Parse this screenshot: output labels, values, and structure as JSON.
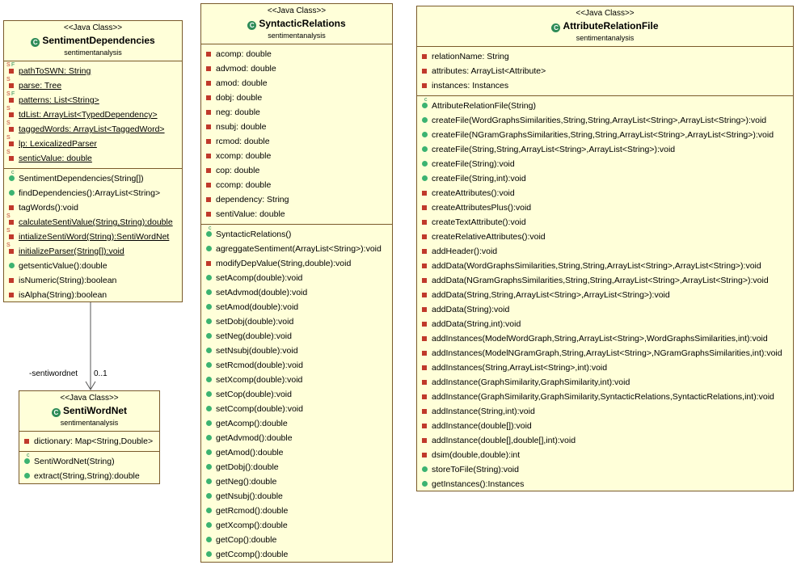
{
  "classes": [
    {
      "id": "SentimentDependencies",
      "stereotype": "<<Java Class>>",
      "name": "SentimentDependencies",
      "package": "sentimentanalysis",
      "fields": [
        {
          "text": "pathToSWN: String",
          "vis": "private",
          "static": true,
          "final": true
        },
        {
          "text": "parse: Tree",
          "vis": "private",
          "static": true,
          "final": false
        },
        {
          "text": "patterns: List<String>",
          "vis": "private",
          "static": true,
          "final": true
        },
        {
          "text": "tdList: ArrayList<TypedDependency>",
          "vis": "private",
          "static": true,
          "final": false
        },
        {
          "text": "taggedWords: ArrayList<TaggedWord>",
          "vis": "private",
          "static": true,
          "final": false
        },
        {
          "text": "lp: LexicalizedParser",
          "vis": "private",
          "static": true,
          "final": false
        },
        {
          "text": "senticValue: double",
          "vis": "private",
          "static": true,
          "final": false
        }
      ],
      "methods": [
        {
          "text": "SentimentDependencies(String[])",
          "vis": "ctor",
          "static": false
        },
        {
          "text": "findDependencies():ArrayList<String>",
          "vis": "public",
          "static": false
        },
        {
          "text": "tagWords():void",
          "vis": "private",
          "static": false
        },
        {
          "text": "calculateSentiValue(String,String):double",
          "vis": "private",
          "static": true
        },
        {
          "text": "intializeSentiWord(String):SentiWordNet",
          "vis": "private",
          "static": true
        },
        {
          "text": "initializeParser(String[]):void",
          "vis": "private",
          "static": true
        },
        {
          "text": "getsenticValue():double",
          "vis": "public",
          "static": false
        },
        {
          "text": "isNumeric(String):boolean",
          "vis": "private",
          "static": false
        },
        {
          "text": "isAlpha(String):boolean",
          "vis": "private",
          "static": false
        }
      ]
    },
    {
      "id": "SentiWordNet",
      "stereotype": "<<Java Class>>",
      "name": "SentiWordNet",
      "package": "sentimentanalysis",
      "fields": [
        {
          "text": "dictionary: Map<String,Double>",
          "vis": "private",
          "static": false,
          "final": false
        }
      ],
      "methods": [
        {
          "text": "SentiWordNet(String)",
          "vis": "ctor",
          "static": false
        },
        {
          "text": "extract(String,String):double",
          "vis": "public",
          "static": false
        }
      ]
    },
    {
      "id": "SyntacticRelations",
      "stereotype": "<<Java Class>>",
      "name": "SyntacticRelations",
      "package": "sentimentanalysis",
      "fields": [
        {
          "text": "acomp: double",
          "vis": "private"
        },
        {
          "text": "advmod: double",
          "vis": "private"
        },
        {
          "text": "amod: double",
          "vis": "private"
        },
        {
          "text": "dobj: double",
          "vis": "private"
        },
        {
          "text": "neg: double",
          "vis": "private"
        },
        {
          "text": "nsubj: double",
          "vis": "private"
        },
        {
          "text": "rcmod: double",
          "vis": "private"
        },
        {
          "text": "xcomp: double",
          "vis": "private"
        },
        {
          "text": "cop: double",
          "vis": "private"
        },
        {
          "text": "ccomp: double",
          "vis": "private"
        },
        {
          "text": "dependency: String",
          "vis": "private"
        },
        {
          "text": "sentiValue: double",
          "vis": "private"
        }
      ],
      "methods": [
        {
          "text": "SyntacticRelations()",
          "vis": "ctor"
        },
        {
          "text": "agreggateSentiment(ArrayList<String>):void",
          "vis": "public"
        },
        {
          "text": "modifyDepValue(String,double):void",
          "vis": "private"
        },
        {
          "text": "setAcomp(double):void",
          "vis": "public"
        },
        {
          "text": "setAdvmod(double):void",
          "vis": "public"
        },
        {
          "text": "setAmod(double):void",
          "vis": "public"
        },
        {
          "text": "setDobj(double):void",
          "vis": "public"
        },
        {
          "text": "setNeg(double):void",
          "vis": "public"
        },
        {
          "text": "setNsubj(double):void",
          "vis": "public"
        },
        {
          "text": "setRcmod(double):void",
          "vis": "public"
        },
        {
          "text": "setXcomp(double):void",
          "vis": "public"
        },
        {
          "text": "setCop(double):void",
          "vis": "public"
        },
        {
          "text": "setCcomp(double):void",
          "vis": "public"
        },
        {
          "text": "getAcomp():double",
          "vis": "public"
        },
        {
          "text": "getAdvmod():double",
          "vis": "public"
        },
        {
          "text": "getAmod():double",
          "vis": "public"
        },
        {
          "text": "getDobj():double",
          "vis": "public"
        },
        {
          "text": "getNeg():double",
          "vis": "public"
        },
        {
          "text": "getNsubj():double",
          "vis": "public"
        },
        {
          "text": "getRcmod():double",
          "vis": "public"
        },
        {
          "text": "getXcomp():double",
          "vis": "public"
        },
        {
          "text": "getCop():double",
          "vis": "public"
        },
        {
          "text": "getCcomp():double",
          "vis": "public"
        }
      ]
    },
    {
      "id": "AttributeRelationFile",
      "stereotype": "<<Java Class>>",
      "name": "AttributeRelationFile",
      "package": "sentimentanalysis",
      "fields": [
        {
          "text": "relationName: String",
          "vis": "private"
        },
        {
          "text": "attributes: ArrayList<Attribute>",
          "vis": "private"
        },
        {
          "text": "instances: Instances",
          "vis": "private"
        }
      ],
      "methods": [
        {
          "text": "AttributeRelationFile(String)",
          "vis": "ctor"
        },
        {
          "text": "createFile(WordGraphsSimilarities,String,String,ArrayList<String>,ArrayList<String>):void",
          "vis": "public"
        },
        {
          "text": "createFile(NGramGraphsSimilarities,String,String,ArrayList<String>,ArrayList<String>):void",
          "vis": "public"
        },
        {
          "text": "createFile(String,String,ArrayList<String>,ArrayList<String>):void",
          "vis": "public"
        },
        {
          "text": "createFile(String):void",
          "vis": "public"
        },
        {
          "text": "createFile(String,int):void",
          "vis": "public"
        },
        {
          "text": "createAttributes():void",
          "vis": "private"
        },
        {
          "text": "createAttributesPlus():void",
          "vis": "private"
        },
        {
          "text": "createTextAttribute():void",
          "vis": "private"
        },
        {
          "text": "createRelativeAttributes():void",
          "vis": "private"
        },
        {
          "text": "addHeader():void",
          "vis": "private"
        },
        {
          "text": "addData(WordGraphsSimilarities,String,String,ArrayList<String>,ArrayList<String>):void",
          "vis": "private"
        },
        {
          "text": "addData(NGramGraphsSimilarities,String,String,ArrayList<String>,ArrayList<String>):void",
          "vis": "private"
        },
        {
          "text": "addData(String,String,ArrayList<String>,ArrayList<String>):void",
          "vis": "private"
        },
        {
          "text": "addData(String):void",
          "vis": "private"
        },
        {
          "text": "addData(String,int):void",
          "vis": "private"
        },
        {
          "text": "addInstances(ModelWordGraph,String,ArrayList<String>,WordGraphsSimilarities,int):void",
          "vis": "private"
        },
        {
          "text": "addInstances(ModelNGramGraph,String,ArrayList<String>,NGramGraphsSimilarities,int):void",
          "vis": "private"
        },
        {
          "text": "addInstances(String,ArrayList<String>,int):void",
          "vis": "private"
        },
        {
          "text": "addInstance(GraphSimilarity,GraphSimilarity,int):void",
          "vis": "private"
        },
        {
          "text": "addInstance(GraphSimilarity,GraphSimilarity,SyntacticRelations,SyntacticRelations,int):void",
          "vis": "private"
        },
        {
          "text": "addInstance(String,int):void",
          "vis": "private"
        },
        {
          "text": "addInstance(double[]):void",
          "vis": "private"
        },
        {
          "text": "addInstance(double[],double[],int):void",
          "vis": "private"
        },
        {
          "text": "dsim(double,double):int",
          "vis": "private"
        },
        {
          "text": "storeToFile(String):void",
          "vis": "public"
        },
        {
          "text": "getInstances():Instances",
          "vis": "public"
        }
      ]
    }
  ],
  "association": {
    "role": "-sentiwordnet",
    "multiplicity": "0..1"
  },
  "colors": {
    "class_fill": "#ffffd9",
    "class_border": "#7a5a2a",
    "private": "#c0392b",
    "public": "#3cb371"
  }
}
